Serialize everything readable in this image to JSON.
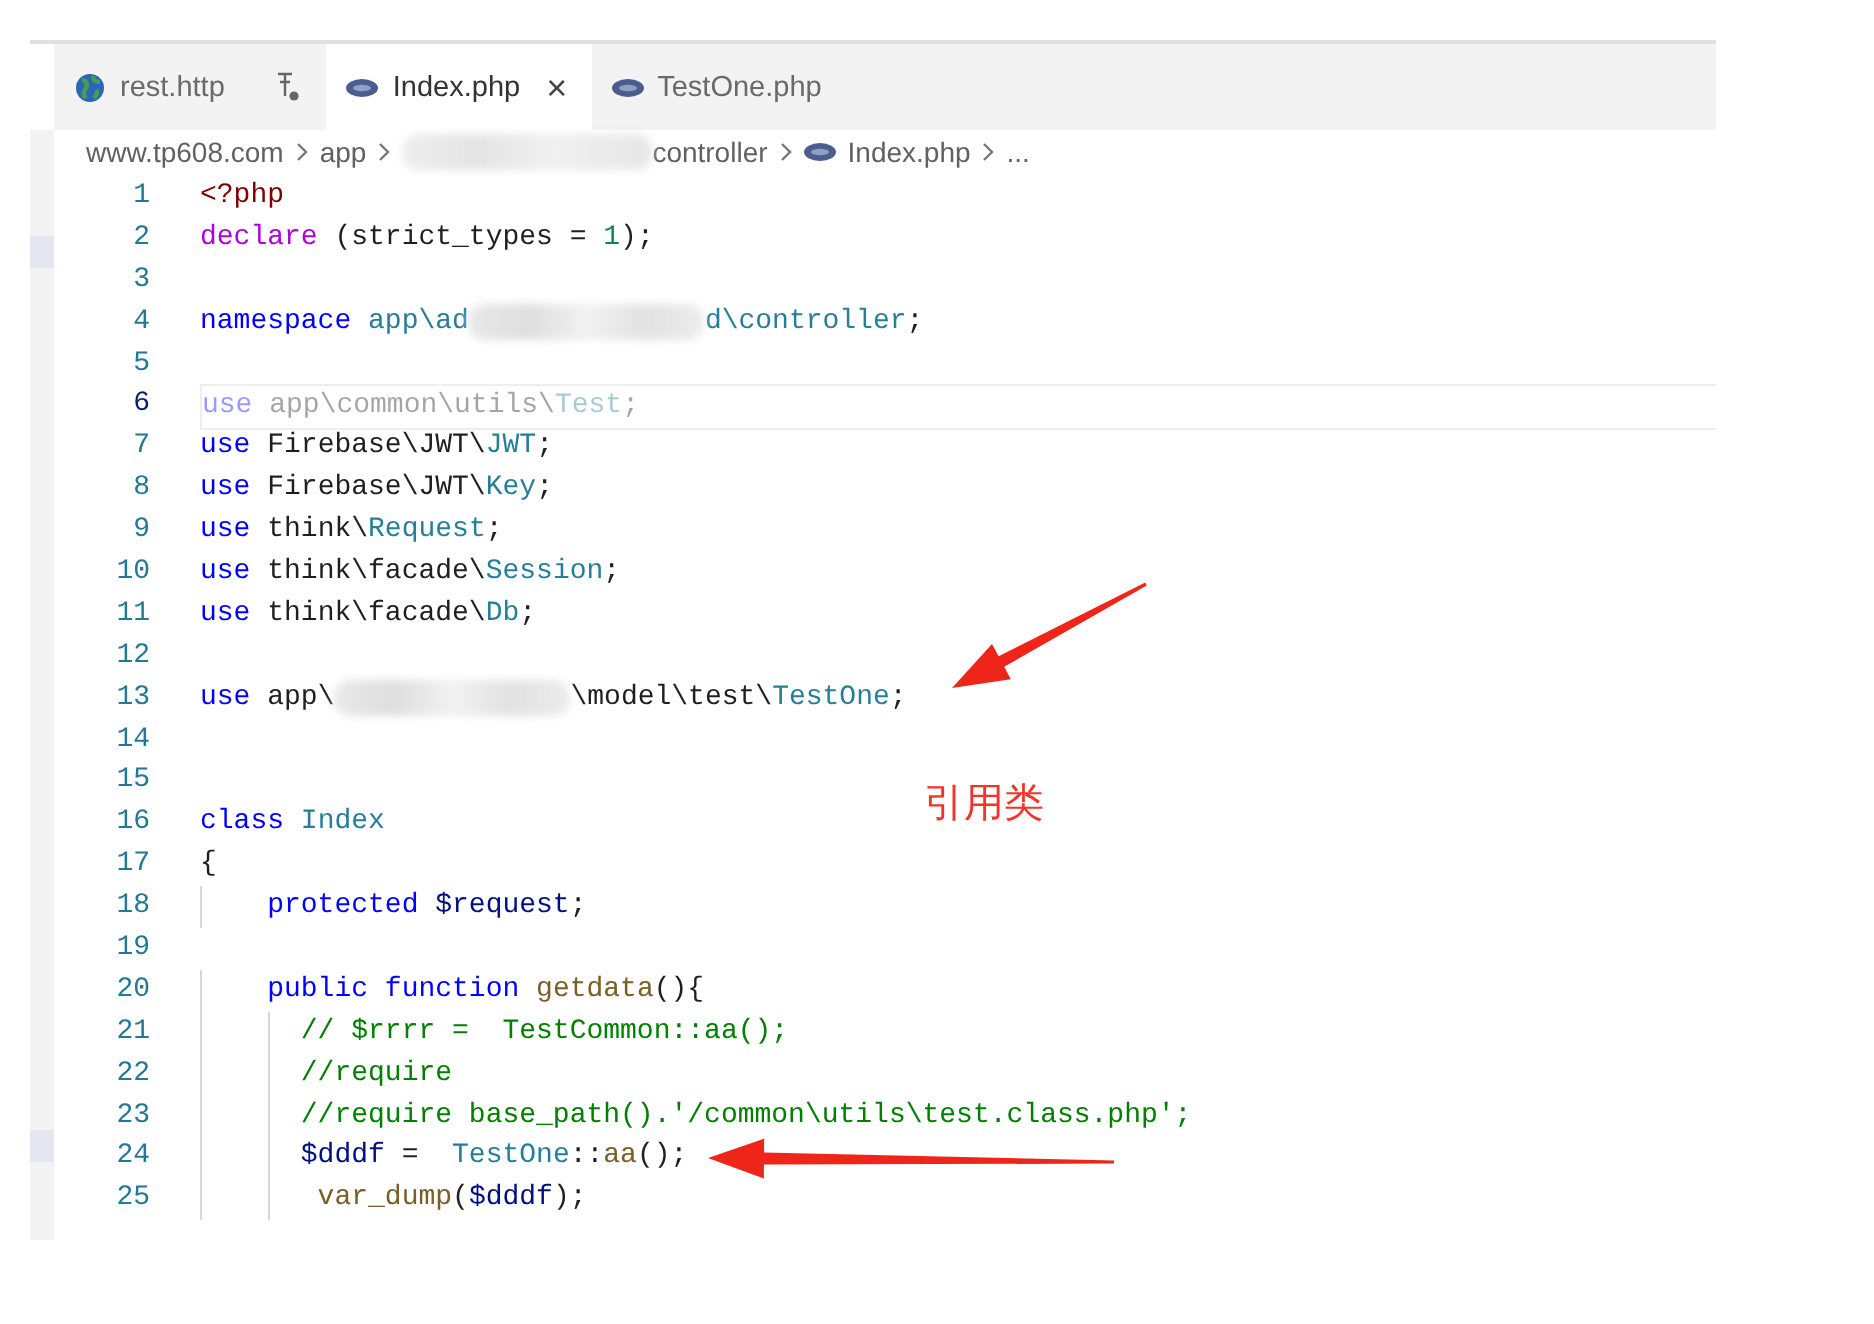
{
  "tabs": [
    {
      "label": "rest.http",
      "kind": "http",
      "selected": false,
      "pinned": true
    },
    {
      "label": "Index.php",
      "kind": "php",
      "selected": true,
      "close": "×"
    },
    {
      "label": "TestOne.php",
      "kind": "php",
      "selected": false
    }
  ],
  "breadcrumb": [
    {
      "kind": "text",
      "label": "www.tp608.com"
    },
    {
      "kind": "text",
      "label": "app"
    },
    {
      "kind": "blur"
    },
    {
      "kind": "text",
      "label": "controller"
    },
    {
      "kind": "file",
      "label": "Index.php"
    },
    {
      "kind": "text",
      "label": "..."
    }
  ],
  "lines": [
    {
      "n": "1",
      "faded": false,
      "current": false,
      "tokens": [
        {
          "text": "<?php",
          "kind": "tag"
        }
      ]
    },
    {
      "n": "2",
      "faded": false,
      "current": false,
      "tokens": [
        {
          "text": "declare",
          "kind": "ctl"
        },
        {
          "text": " (strict_types = ",
          "kind": "plain"
        },
        {
          "text": "1",
          "kind": "num"
        },
        {
          "text": ");",
          "kind": "plain"
        }
      ]
    },
    {
      "n": "3",
      "current": false
    },
    {
      "n": "4",
      "faded": false,
      "current": false,
      "tokens": [
        {
          "text": "namespace",
          "kind": "kw"
        },
        {
          "text": " app\\ad",
          "kind": "type"
        },
        {
          "kind": "blur"
        },
        {
          "text": "d\\controller",
          "kind": "type"
        },
        {
          "text": ";",
          "kind": "plain"
        }
      ]
    },
    {
      "n": "5",
      "current": false
    },
    {
      "n": "6",
      "faded": true,
      "current": true,
      "tokens": [
        {
          "text": "use",
          "kind": "kw"
        },
        {
          "text": " app\\common\\utils\\",
          "kind": "plain"
        },
        {
          "text": "Test",
          "kind": "type"
        },
        {
          "text": ";",
          "kind": "plain"
        }
      ]
    },
    {
      "n": "7",
      "faded": false,
      "current": false,
      "tokens": [
        {
          "text": "use",
          "kind": "kw"
        },
        {
          "text": " Firebase\\JWT\\",
          "kind": "plain"
        },
        {
          "text": "JWT",
          "kind": "type"
        },
        {
          "text": ";",
          "kind": "plain"
        }
      ]
    },
    {
      "n": "8",
      "faded": false,
      "current": false,
      "tokens": [
        {
          "text": "use",
          "kind": "kw"
        },
        {
          "text": " Firebase\\JWT\\",
          "kind": "plain"
        },
        {
          "text": "Key",
          "kind": "type"
        },
        {
          "text": ";",
          "kind": "plain"
        }
      ]
    },
    {
      "n": "9",
      "faded": false,
      "current": false,
      "tokens": [
        {
          "text": "use",
          "kind": "kw"
        },
        {
          "text": " think\\",
          "kind": "plain"
        },
        {
          "text": "Request",
          "kind": "type"
        },
        {
          "text": ";",
          "kind": "plain"
        }
      ]
    },
    {
      "n": "10",
      "faded": false,
      "current": false,
      "tokens": [
        {
          "text": "use",
          "kind": "kw"
        },
        {
          "text": " think\\facade\\",
          "kind": "plain"
        },
        {
          "text": "Session",
          "kind": "type"
        },
        {
          "text": ";",
          "kind": "plain"
        }
      ]
    },
    {
      "n": "11",
      "faded": false,
      "current": false,
      "tokens": [
        {
          "text": "use",
          "kind": "kw"
        },
        {
          "text": " think\\facade\\",
          "kind": "plain"
        },
        {
          "text": "Db",
          "kind": "type"
        },
        {
          "text": ";",
          "kind": "plain"
        }
      ]
    },
    {
      "n": "12",
      "current": false
    },
    {
      "n": "13",
      "faded": false,
      "current": false,
      "tokens": [
        {
          "text": "use",
          "kind": "kw"
        },
        {
          "text": " app\\",
          "kind": "plain"
        },
        {
          "kind": "blur"
        },
        {
          "text": "\\model\\test\\",
          "kind": "plain"
        },
        {
          "text": "TestOne",
          "kind": "type"
        },
        {
          "text": ";",
          "kind": "plain"
        }
      ]
    },
    {
      "n": "14",
      "current": false
    },
    {
      "n": "15",
      "current": false
    },
    {
      "n": "16",
      "faded": false,
      "current": false,
      "tokens": [
        {
          "text": "class",
          "kind": "kw"
        },
        {
          "text": " Index",
          "kind": "type"
        }
      ]
    },
    {
      "n": "17",
      "faded": false,
      "current": false,
      "tokens": [
        {
          "text": "{",
          "kind": "plain"
        }
      ]
    },
    {
      "n": "18",
      "faded": false,
      "current": false,
      "tokens": [
        {
          "text": "    protected",
          "kind": "kw"
        },
        {
          "text": " $request",
          "kind": "var"
        },
        {
          "text": ";",
          "kind": "plain"
        }
      ]
    },
    {
      "n": "19",
      "current": false
    },
    {
      "n": "20",
      "faded": false,
      "current": false,
      "tokens": [
        {
          "text": "    public function",
          "kind": "kw"
        },
        {
          "text": " getdata",
          "kind": "fn"
        },
        {
          "text": "(){",
          "kind": "plain"
        }
      ]
    },
    {
      "n": "21",
      "faded": false,
      "current": false,
      "tokens": [
        {
          "text": "      // $rrrr =  TestCommon::aa();",
          "kind": "comment"
        }
      ]
    },
    {
      "n": "22",
      "faded": false,
      "current": false,
      "tokens": [
        {
          "text": "      //require",
          "kind": "comment"
        }
      ]
    },
    {
      "n": "23",
      "faded": false,
      "current": false,
      "tokens": [
        {
          "text": "      //require base_path().'/common\\utils\\test.class.php';",
          "kind": "comment"
        }
      ]
    },
    {
      "n": "24",
      "faded": false,
      "current": false,
      "tokens": [
        {
          "text": "      $dddf",
          "kind": "var"
        },
        {
          "text": " =  ",
          "kind": "plain"
        },
        {
          "text": "TestOne",
          "kind": "type"
        },
        {
          "text": "::",
          "kind": "plain"
        },
        {
          "text": "aa",
          "kind": "fn"
        },
        {
          "text": "();",
          "kind": "plain"
        }
      ]
    },
    {
      "n": "25",
      "faded": false,
      "current": false,
      "tokens": [
        {
          "text": "       var_dump",
          "kind": "fn"
        },
        {
          "text": "(",
          "kind": "plain"
        },
        {
          "text": "$dddf",
          "kind": "var"
        },
        {
          "text": ");",
          "kind": "plain"
        }
      ]
    }
  ],
  "annotation": {
    "label": "引用类"
  }
}
